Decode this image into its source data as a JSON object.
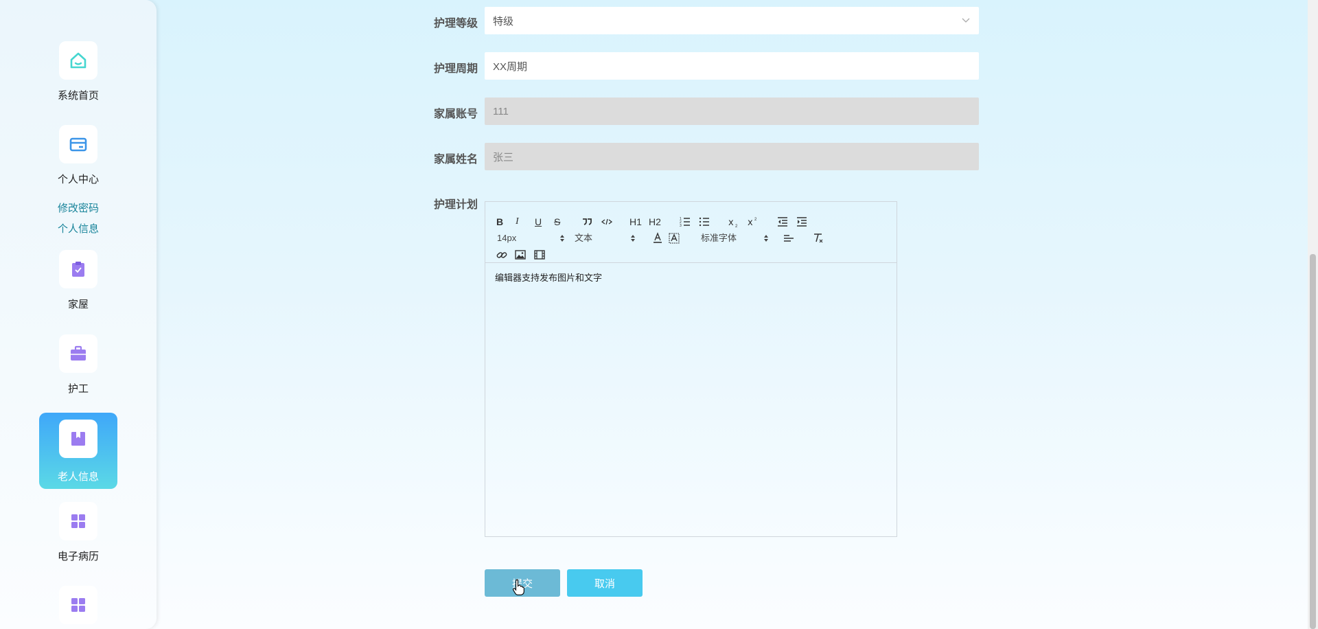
{
  "sidebar": {
    "items": [
      {
        "label": "系统首页",
        "icon": "home-icon"
      },
      {
        "label": "个人中心",
        "icon": "wallet-icon"
      },
      {
        "label": "家屋",
        "icon": "clipboard-icon"
      },
      {
        "label": "护工",
        "icon": "briefcase-icon"
      },
      {
        "label": "老人信息",
        "icon": "book-icon"
      },
      {
        "label": "电子病历",
        "icon": "grid-icon"
      },
      {
        "label": "",
        "icon": "grid-icon"
      }
    ],
    "sub_links": [
      "修改密码",
      "个人信息"
    ],
    "colors": {
      "icon_teal": "#45d6d0",
      "icon_blue": "#3b95e8",
      "icon_purple": "#9b7cf0",
      "active_top": "#3fa7f9",
      "active_bottom": "#5bd9e6"
    }
  },
  "form": {
    "care_level": {
      "label": "护理等级",
      "value": "特级"
    },
    "care_cycle": {
      "label": "护理周期",
      "value": "XX周期"
    },
    "family_account": {
      "label": "家属账号",
      "value": "111"
    },
    "family_name": {
      "label": "家属姓名",
      "value": "张三"
    },
    "care_plan": {
      "label": "护理计划"
    }
  },
  "editor": {
    "toolbar": {
      "bold": "B",
      "italic": "I",
      "underline": "U",
      "strike": "S",
      "h1": "H1",
      "h2": "H2",
      "size": "14px",
      "header": "文本",
      "font": "标准字体"
    },
    "content": "编辑器支持发布图片和文字"
  },
  "buttons": {
    "submit": "提交",
    "cancel": "取消"
  }
}
